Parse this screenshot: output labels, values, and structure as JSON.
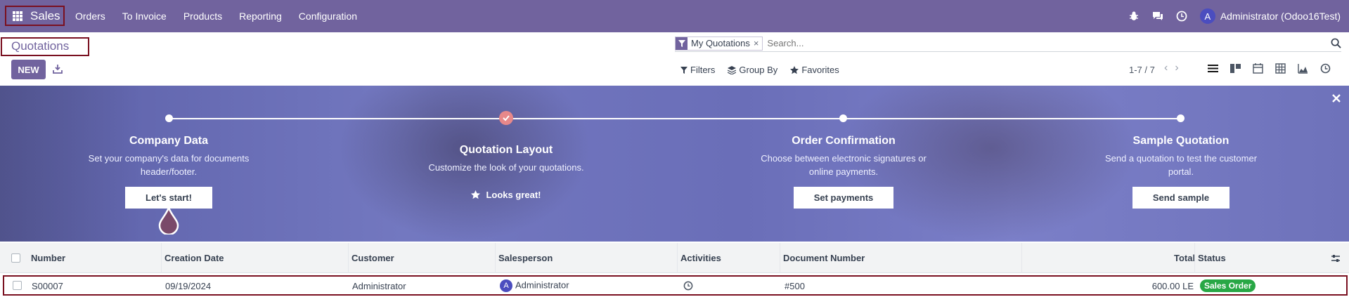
{
  "nav": {
    "app_name": "Sales",
    "menu": [
      "Orders",
      "To Invoice",
      "Products",
      "Reporting",
      "Configuration"
    ],
    "user": "Administrator (Odoo16Test)",
    "user_initial": "A"
  },
  "control": {
    "breadcrumb": "Quotations",
    "new_label": "NEW",
    "facet": "My Quotations",
    "facet_remove": "×",
    "search_placeholder": "Search...",
    "filters_label": "Filters",
    "groupby_label": "Group By",
    "favorites_label": "Favorites",
    "pager": "1-7 / 7",
    "pager_prev": "‹",
    "pager_next": "›"
  },
  "onboarding": {
    "steps": [
      {
        "title": "Company Data",
        "desc_line1": "Set your company's data for documents",
        "desc_line2": "header/footer.",
        "button": "Let's start!"
      },
      {
        "title": "Quotation Layout",
        "desc_line1": "Customize the look of your quotations.",
        "done": "Looks great!"
      },
      {
        "title": "Order Confirmation",
        "desc_line1": "Choose between electronic signatures or",
        "desc_line2": "online payments.",
        "button": "Set payments"
      },
      {
        "title": "Sample Quotation",
        "desc_line1": "Send a quotation to test the customer",
        "desc_line2": "portal.",
        "button": "Send sample"
      }
    ]
  },
  "table": {
    "columns": [
      "Number",
      "Creation Date",
      "Customer",
      "Salesperson",
      "Activities",
      "Document Number",
      "Total",
      "Status"
    ],
    "rows": [
      {
        "number": "S00007",
        "creation_date": "09/19/2024",
        "customer": "Administrator",
        "salesperson": "Administrator",
        "salesperson_initial": "A",
        "document_number": "#500",
        "total": "600.00 LE",
        "status": "Sales Order"
      }
    ]
  },
  "colors": {
    "brand": "#71639e",
    "highlight": "#7a1020",
    "status_green": "#28a745"
  }
}
